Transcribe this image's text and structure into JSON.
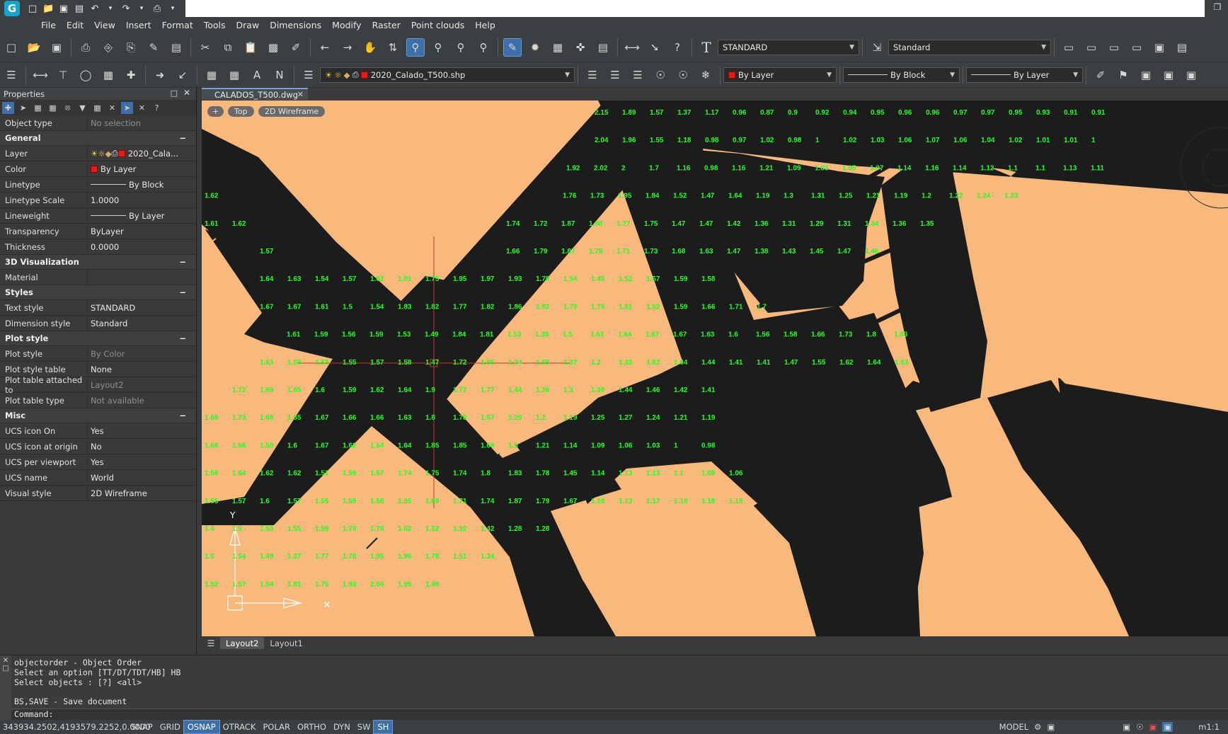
{
  "titlebar": {
    "logo_letter": "G",
    "quick_access_icons": [
      "new-file-icon",
      "open-folder-icon",
      "save-icon",
      "save-all-icon",
      "undo-icon",
      "undo-dropdown-icon",
      "redo-icon",
      "redo-dropdown-icon",
      "print-icon",
      "customize-icon"
    ]
  },
  "menu": [
    "File",
    "Edit",
    "View",
    "Insert",
    "Format",
    "Tools",
    "Draw",
    "Dimensions",
    "Modify",
    "Raster",
    "Point clouds",
    "Help"
  ],
  "toolbar1": {
    "text_style": "STANDARD",
    "dim_style": "Standard"
  },
  "toolbar2": {
    "layer": "2020_Calado_T500.shp",
    "color": "By Layer",
    "linetype": "By Block",
    "lineweight": "By Layer"
  },
  "properties": {
    "title": "Properties",
    "object_type": {
      "key": "Object type",
      "value": "No selection"
    },
    "groups": [
      {
        "name": "General",
        "rows": [
          {
            "key": "Layer",
            "value": "2020_Cala..."
          },
          {
            "key": "Color",
            "value": "By Layer"
          },
          {
            "key": "Linetype",
            "value": "By Block"
          },
          {
            "key": "Linetype Scale",
            "value": "1.0000"
          },
          {
            "key": "Lineweight",
            "value": "By Layer"
          },
          {
            "key": "Transparency",
            "value": "ByLayer"
          },
          {
            "key": "Thickness",
            "value": "0.0000"
          }
        ]
      },
      {
        "name": "3D Visualization",
        "rows": [
          {
            "key": "Material",
            "value": ""
          }
        ]
      },
      {
        "name": "Styles",
        "rows": [
          {
            "key": "Text style",
            "value": "STANDARD"
          },
          {
            "key": "Dimension style",
            "value": "Standard"
          }
        ]
      },
      {
        "name": "Plot style",
        "rows": [
          {
            "key": "Plot style",
            "value": "By Color"
          },
          {
            "key": "Plot style table",
            "value": "None"
          },
          {
            "key": "Plot table attached to",
            "value": "Layout2"
          },
          {
            "key": "Plot table type",
            "value": "Not available"
          }
        ]
      },
      {
        "name": "Misc",
        "rows": [
          {
            "key": "UCS icon On",
            "value": "Yes"
          },
          {
            "key": "UCS icon at origin",
            "value": "No"
          },
          {
            "key": "UCS per viewport",
            "value": "Yes"
          },
          {
            "key": "UCS name",
            "value": "World"
          },
          {
            "key": "Visual style",
            "value": "2D Wireframe"
          }
        ]
      }
    ]
  },
  "document_tab": "CALADOS_T500.dwg",
  "viewport": {
    "plus": "+",
    "view": "Top",
    "visual_style": "2D Wireframe"
  },
  "depth_labels": [
    [
      "2.15",
      "1.89",
      "1.57",
      "1.37",
      "1.17",
      "0.96",
      "0.87",
      "0.9",
      "0.92",
      "0.94",
      "0.95",
      "0.96",
      "0.96",
      "0.97",
      "0.97",
      "0.95",
      "0.93",
      "0.91",
      "0.91"
    ],
    [
      "2.04",
      "1.96",
      "1.55",
      "1.18",
      "0.98",
      "0.97",
      "1.02",
      "0.98",
      "1",
      "1.02",
      "1.03",
      "1.06",
      "1.07",
      "1.06",
      "1.04",
      "1.02",
      "1.01",
      "1.01",
      "1"
    ],
    [
      "1.92",
      "2.02",
      "2",
      "1.7",
      "1.16",
      "0.98",
      "1.16",
      "1.21",
      "1.09",
      "1.03",
      "1.05",
      "1.07",
      "1.14",
      "1.16",
      "1.14",
      "1.12",
      "1.1",
      "1.1",
      "1.13",
      "1.11"
    ],
    [
      "1.62",
      "1.76",
      "1.73",
      "1.95",
      "1.84",
      "1.52",
      "1.47",
      "1.64",
      "1.19",
      "1.3",
      "1.31",
      "1.25",
      "1.21",
      "1.19",
      "1.2",
      "1.22",
      "1.24",
      "1.23"
    ],
    [
      "1.61",
      "1.62",
      "1.74",
      "1.72",
      "1.87",
      "1.88",
      "1.77",
      "1.75",
      "1.47",
      "1.47",
      "1.42",
      "1.36",
      "1.31",
      "1.29",
      "1.31",
      "1.34",
      "1.36",
      "1.35"
    ],
    [
      "1.57",
      "1.66",
      "1.79",
      "1.87",
      "1.78",
      "1.71",
      "1.73",
      "1.68",
      "1.63",
      "1.47",
      "1.38",
      "1.43",
      "1.45",
      "1.47",
      "1.46"
    ],
    [
      "1.64",
      "1.63",
      "1.54",
      "1.57",
      "1.62",
      "1.81",
      "1.75",
      "1.95",
      "1.97",
      "1.93",
      "1.79",
      "1.54",
      "1.45",
      "1.52",
      "1.57",
      "1.59",
      "1.58"
    ],
    [
      "1.67",
      "1.67",
      "1.61",
      "1.5",
      "1.54",
      "1.83",
      "1.82",
      "1.77",
      "1.82",
      "1.86",
      "1.82",
      "1.79",
      "1.75",
      "1.61",
      "1.52",
      "1.59",
      "1.66",
      "1.71",
      "1.7"
    ],
    [
      "1.61",
      "1.59",
      "1.56",
      "1.59",
      "1.53",
      "1.49",
      "1.84",
      "1.81",
      "1.53",
      "1.35",
      "1.5",
      "1.61",
      "1.64",
      "1.67",
      "1.67",
      "1.63",
      "1.6",
      "1.56",
      "1.58",
      "1.66",
      "1.73",
      "1.8",
      "1.83"
    ],
    [
      "1.63",
      "1.58",
      "1.53",
      "1.55",
      "1.57",
      "1.58",
      "1.47",
      "1.72",
      "1.85",
      "1.74",
      "1.59",
      "1.37",
      "1.2",
      "1.33",
      "1.62",
      "1.64",
      "1.44",
      "1.41",
      "1.41",
      "1.47",
      "1.55",
      "1.62",
      "1.64",
      "1.63"
    ],
    [
      "1.72",
      "1.69",
      "1.65",
      "1.6",
      "1.59",
      "1.62",
      "1.64",
      "1.9",
      "1.77",
      "1.77",
      "1.44",
      "1.26",
      "1.3",
      "1.36",
      "1.44",
      "1.46",
      "1.42",
      "1.41"
    ],
    [
      "1.69",
      "1.73",
      "1.68",
      "1.65",
      "1.67",
      "1.66",
      "1.66",
      "1.63",
      "1.8",
      "1.78",
      "1.57",
      "1.29",
      "1.2",
      "1.19",
      "1.25",
      "1.27",
      "1.24",
      "1.21",
      "1.19"
    ],
    [
      "1.66",
      "1.66",
      "1.59",
      "1.6",
      "1.67",
      "1.62",
      "1.64",
      "1.64",
      "1.85",
      "1.85",
      "1.68",
      "1.5",
      "1.21",
      "1.14",
      "1.09",
      "1.06",
      "1.03",
      "1",
      "0.98"
    ],
    [
      "1.56",
      "1.64",
      "1.62",
      "1.62",
      "1.51",
      "1.59",
      "1.57",
      "1.74",
      "1.75",
      "1.74",
      "1.8",
      "1.83",
      "1.78",
      "1.45",
      "1.14",
      "1.13",
      "1.13",
      "1.1",
      "1.08",
      "1.06"
    ],
    [
      "1.55",
      "1.57",
      "1.6",
      "1.57",
      "1.55",
      "1.59",
      "1.58",
      "1.65",
      "1.69",
      "1.71",
      "1.74",
      "1.87",
      "1.79",
      "1.67",
      "1.19",
      "1.13",
      "1.17",
      "1.18",
      "1.18",
      "1.18"
    ],
    [
      "1.4",
      "1.5",
      "1.53",
      "1.55",
      "1.59",
      "1.79",
      "1.78",
      "1.62",
      "1.12",
      "1.32",
      "1.42",
      "1.28",
      "1.28"
    ],
    [
      "1.5",
      "1.54",
      "1.49",
      "1.37",
      "1.77",
      "1.78",
      "1.95",
      "1.96",
      "1.78",
      "1.51",
      "1.34"
    ],
    [
      "1.52",
      "1.57",
      "1.54",
      "1.81",
      "1.75",
      "1.93",
      "2.04",
      "1.95",
      "1.86"
    ]
  ],
  "layouts": [
    "Layout2",
    "Layout1"
  ],
  "command_history": [
    "objectorder - Object Order",
    "Select an option [TT/DT/TDT/HB] HB",
    "Select objects : [?] <all>",
    "",
    "BS,SAVE - Save document"
  ],
  "command_prompt": "Command:",
  "status": {
    "coords": "343934.2502,4193579.2252,0.0000",
    "toggles": [
      {
        "label": "SNAP",
        "on": false
      },
      {
        "label": "GRID",
        "on": false
      },
      {
        "label": "OSNAP",
        "on": true
      },
      {
        "label": "OTRACK",
        "on": false
      },
      {
        "label": "POLAR",
        "on": false
      },
      {
        "label": "ORTHO",
        "on": false
      },
      {
        "label": "DYN",
        "on": false
      },
      {
        "label": "SW",
        "on": false
      },
      {
        "label": "SH",
        "on": true
      }
    ],
    "model": "MODEL",
    "scale": "m1:1"
  },
  "colors": {
    "canvas_land": "#f9b97d",
    "canvas_water": "#1c1c1c",
    "depth_text": "#22ff22",
    "accent": "#3d6fa8",
    "crosshair": "#c0392b"
  }
}
